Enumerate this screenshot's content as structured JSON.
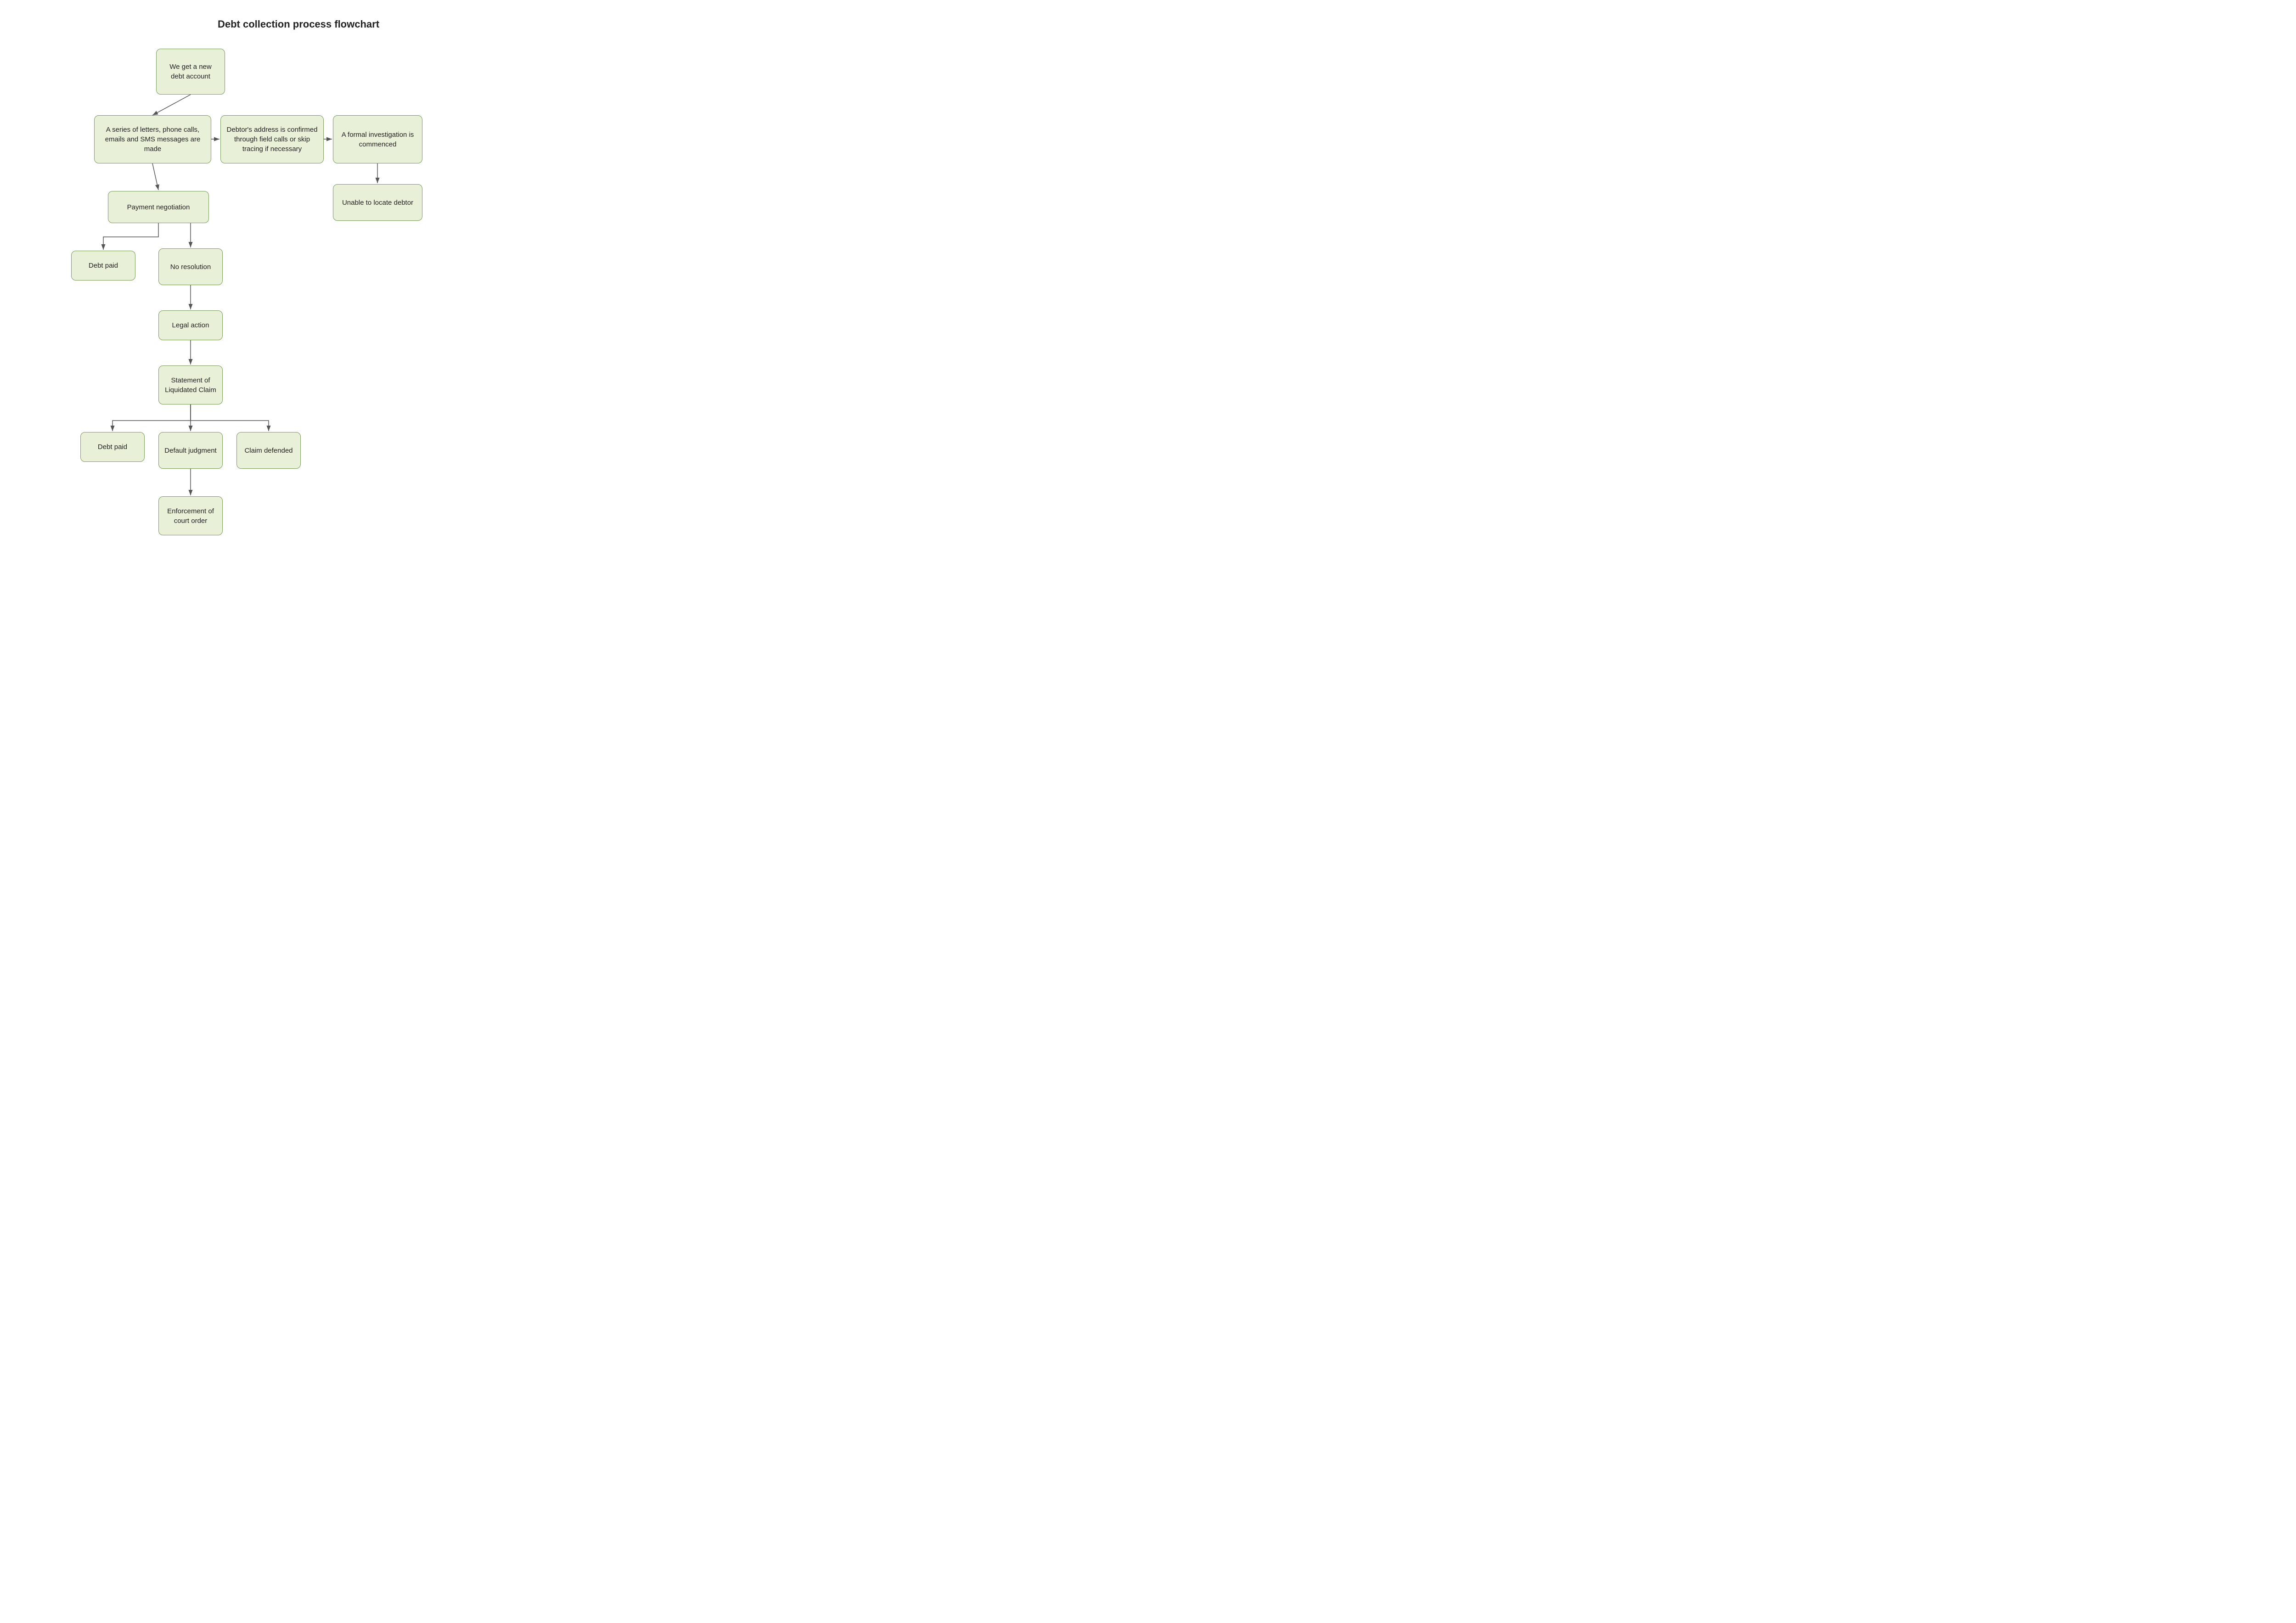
{
  "title": "Debt collection process flowchart",
  "nodes": {
    "new_debt": {
      "label": "We get a new debt account"
    },
    "letters": {
      "label": "A series of letters, phone calls, emails and SMS messages are made"
    },
    "address_confirm": {
      "label": "Debtor's address is confirmed through field calls or skip tracing if necessary"
    },
    "formal_investigation": {
      "label": "A formal investigation is commenced"
    },
    "unable_locate": {
      "label": "Unable to locate debtor"
    },
    "payment_negotiation": {
      "label": "Payment negotiation"
    },
    "debt_paid_1": {
      "label": "Debt paid"
    },
    "no_resolution": {
      "label": "No resolution"
    },
    "legal_action": {
      "label": "Legal action"
    },
    "statement_claim": {
      "label": "Statement of Liquidated Claim"
    },
    "debt_paid_2": {
      "label": "Debt paid"
    },
    "default_judgment": {
      "label": "Default judgment"
    },
    "claim_defended": {
      "label": "Claim defended"
    },
    "enforcement": {
      "label": "Enforcement of court order"
    }
  }
}
